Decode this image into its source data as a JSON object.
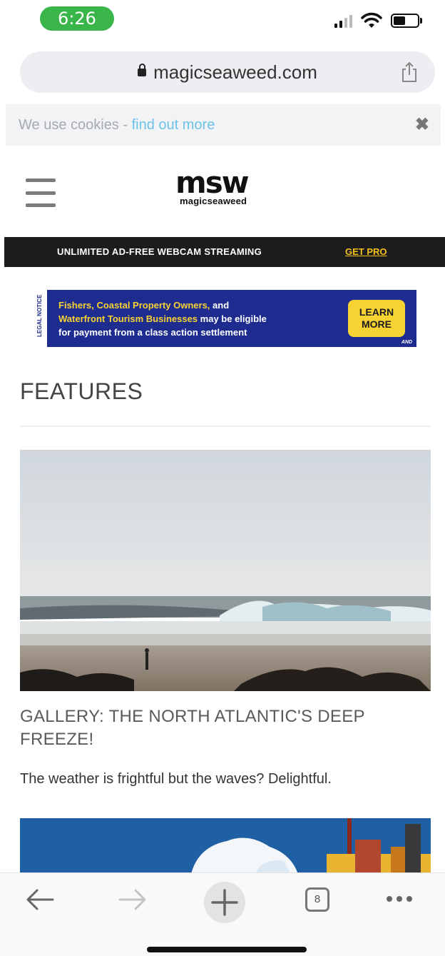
{
  "status_bar": {
    "time": "6:26",
    "icons": [
      "cellular-signal-icon",
      "wifi-icon",
      "battery-icon"
    ],
    "accent_color": "#3ab54a"
  },
  "browser": {
    "url": "magicseaweed.com",
    "tab_count": "8",
    "icons": [
      "lock-icon",
      "share-icon",
      "back-arrow-icon",
      "forward-arrow-icon",
      "plus-icon",
      "tabs-icon",
      "more-icon"
    ]
  },
  "cookie_banner": {
    "text": "We use cookies - ",
    "link_text": "find out more",
    "close_glyph": "✖"
  },
  "header": {
    "logo_mark": "msw",
    "logo_word": "magicseaweed",
    "menu_icon": "hamburger-menu-icon"
  },
  "promo": {
    "text": "UNLIMITED AD-FREE WEBCAM STREAMING",
    "link": "GET PRO",
    "link_color": "#f4c21b"
  },
  "ad": {
    "notice": "LEGAL NOTICE",
    "line1_a": "Fishers, Coastal Property Owners,",
    "line1_b": " and",
    "line2_a": "Waterfront Tourism Businesses",
    "line2_b": " may be eligible",
    "line3": "for payment from a class action settlement",
    "button": "LEARN MORE",
    "mark": "AND",
    "bg_color": "#1f2c8f"
  },
  "features": {
    "heading": "FEATURES",
    "items": [
      {
        "title": "GALLERY: THE NORTH ATLANTIC'S DEEP FREEZE!",
        "description": "The weather is frightful but the waves? Delightful."
      }
    ]
  }
}
